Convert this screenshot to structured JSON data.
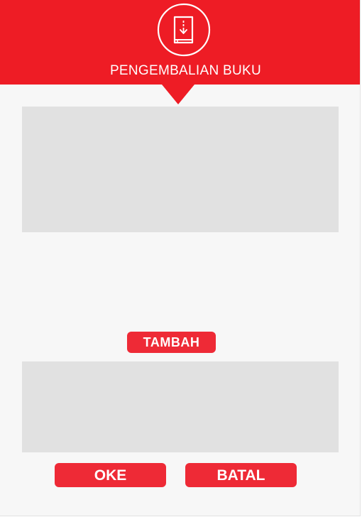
{
  "header": {
    "title": "PENGEMBALIAN BUKU",
    "icon": "book-return-icon",
    "color": "#ee1c25"
  },
  "actions": {
    "add_label": "TAMBAH",
    "ok_label": "OKE",
    "cancel_label": "BATAL"
  },
  "colors": {
    "accent": "#ee1c25",
    "button": "#ee2a36",
    "panel": "#e1e1e1",
    "background": "#f7f7f7"
  }
}
